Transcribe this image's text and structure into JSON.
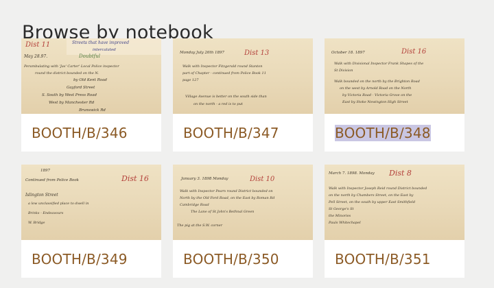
{
  "page": {
    "title": "Browse by notebook"
  },
  "notebooks": [
    {
      "label": "BOOTH/B/346",
      "selected": false,
      "page_texts": [
        "Dist 11",
        "May 28.97.",
        "Streets that have improved",
        "intercalated",
        "Doubtful",
        "Perambulating with 'Jas' Carter' Local Police inspector",
        "round the district bounded on the N.",
        "by Old Kent Road",
        "Gayford Street",
        "S. South by West Press Road",
        "West by Manchester Rd",
        "Brunswick Rd"
      ]
    },
    {
      "label": "BOOTH/B/347",
      "selected": false,
      "page_texts": [
        "Monday July 26th 1897",
        "Dist 13",
        "Walk with Inspector Fitzgerald round Stanton",
        "part of Chapter - continued from Police Book 11",
        "page 127",
        "Village Avenue is better on the south side than",
        "on the north - a red is to put"
      ]
    },
    {
      "label": "BOOTH/B/348",
      "selected": true,
      "page_texts": [
        "October 18. 1897",
        "Dist 16",
        "Walk with Divisional Inspector Frank Shapes of the",
        "St Division",
        "Walk bounded on the north by the Brighton Road",
        "on the west by Arnold Road on the North",
        "by Victoria Road - Victoria Grove on the",
        "East by Stoke Newington High Street"
      ]
    },
    {
      "label": "BOOTH/B/349",
      "selected": false,
      "page_texts": [
        "1897",
        "Dist 16",
        "Continued from Police Book",
        "Islington Street",
        "a low unclassified place to dwell in",
        "Brinks - Endeavours",
        "W. Bridge"
      ]
    },
    {
      "label": "BOOTH/B/350",
      "selected": false,
      "page_texts": [
        "January 3. 1898 Monday",
        "Dist 10",
        "Walk with Inspector Pearn round District bounded on",
        "North by the Old Ford Road, on the East by Roman Rd",
        "Cambridge Road",
        "The Lane of St John's Bethnal Green",
        "The pig at the S.W. corner"
      ]
    },
    {
      "label": "BOOTH/B/351",
      "selected": false,
      "page_texts": [
        "March 7. 1898. Monday",
        "Dist 8",
        "Walk with Inspector Joseph Reid round District bounded",
        "on the north by Chambers Street, on the East by",
        "Pell Street, on the south by upper East Smithfield",
        "St George's St",
        "the Minories",
        "Pauls Whitechapel"
      ]
    }
  ]
}
